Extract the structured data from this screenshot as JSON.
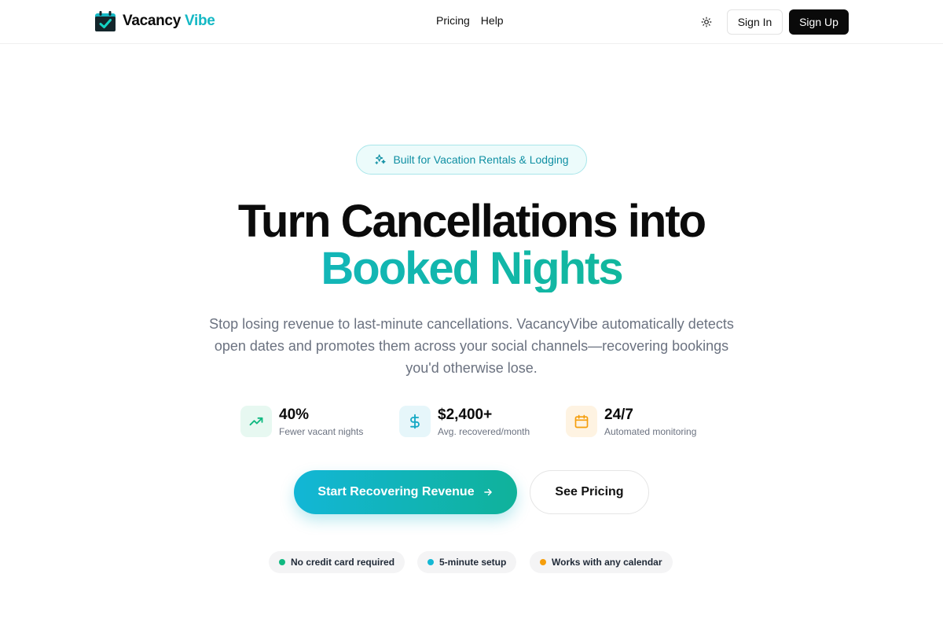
{
  "brand": {
    "name_main": "Vacancy",
    "name_accent": "Vibe"
  },
  "nav": {
    "items": [
      "Pricing",
      "Help"
    ]
  },
  "header": {
    "theme_icon": "sun-icon",
    "sign_in": "Sign In",
    "sign_up": "Sign Up"
  },
  "hero": {
    "badge": "Built for Vacation Rentals & Lodging",
    "headline_line1": "Turn Cancellations into",
    "headline_line2": "Booked Nights",
    "subtitle": "Stop losing revenue to last-minute cancellations. VacancyVibe automatically detects open dates and promotes them across your social channels—recovering bookings you'd otherwise lose."
  },
  "stats": [
    {
      "value": "40%",
      "label": "Fewer vacant nights",
      "icon": "trending-up-icon",
      "color": "#10b981"
    },
    {
      "value": "$2,400+",
      "label": "Avg. recovered/month",
      "icon": "dollar-icon",
      "color": "#14a8c4"
    },
    {
      "value": "24/7",
      "label": "Automated monitoring",
      "icon": "calendar-icon",
      "color": "#f59e0b"
    }
  ],
  "cta": {
    "primary": "Start Recovering Revenue",
    "secondary": "See Pricing"
  },
  "trust": [
    {
      "label": "No credit card required",
      "color": "#10b981"
    },
    {
      "label": "5-minute setup",
      "color": "#14b8d4"
    },
    {
      "label": "Works with any calendar",
      "color": "#f59e0b"
    }
  ],
  "colors": {
    "accent": "#14b8c4",
    "accent_green": "#10b981",
    "dark": "#0a0a0a"
  }
}
